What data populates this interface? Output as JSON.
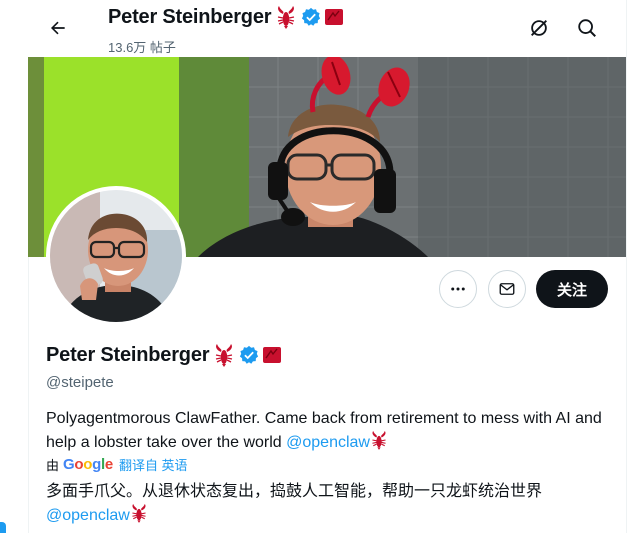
{
  "header": {
    "name": "Peter Steinberger",
    "post_count": "13.6万 帖子"
  },
  "profile": {
    "name": "Peter Steinberger",
    "handle": "@steipete",
    "bio_text": "Polyagentmorous ClawFather. Came back from retirement to mess with AI and help a lobster take over the world ",
    "bio_mention": "@openclaw",
    "follow_label": "关注"
  },
  "translation": {
    "by": "由",
    "google": "Google",
    "action": "翻译自 英语",
    "translated_text": "多面手爪父。从退休状态复出，捣鼓人工智能，帮助一只龙虾统治世界",
    "translated_mention": "@openclaw"
  },
  "colors": {
    "accent": "#1d9bf0",
    "text": "#0f1419",
    "muted": "#536471",
    "lobster": "#c8102e"
  },
  "icons": [
    "back-arrow-icon",
    "lobster-icon",
    "verified-badge-icon",
    "flag-badge-icon",
    "refresh-icon",
    "search-icon",
    "more-icon",
    "mail-icon"
  ]
}
